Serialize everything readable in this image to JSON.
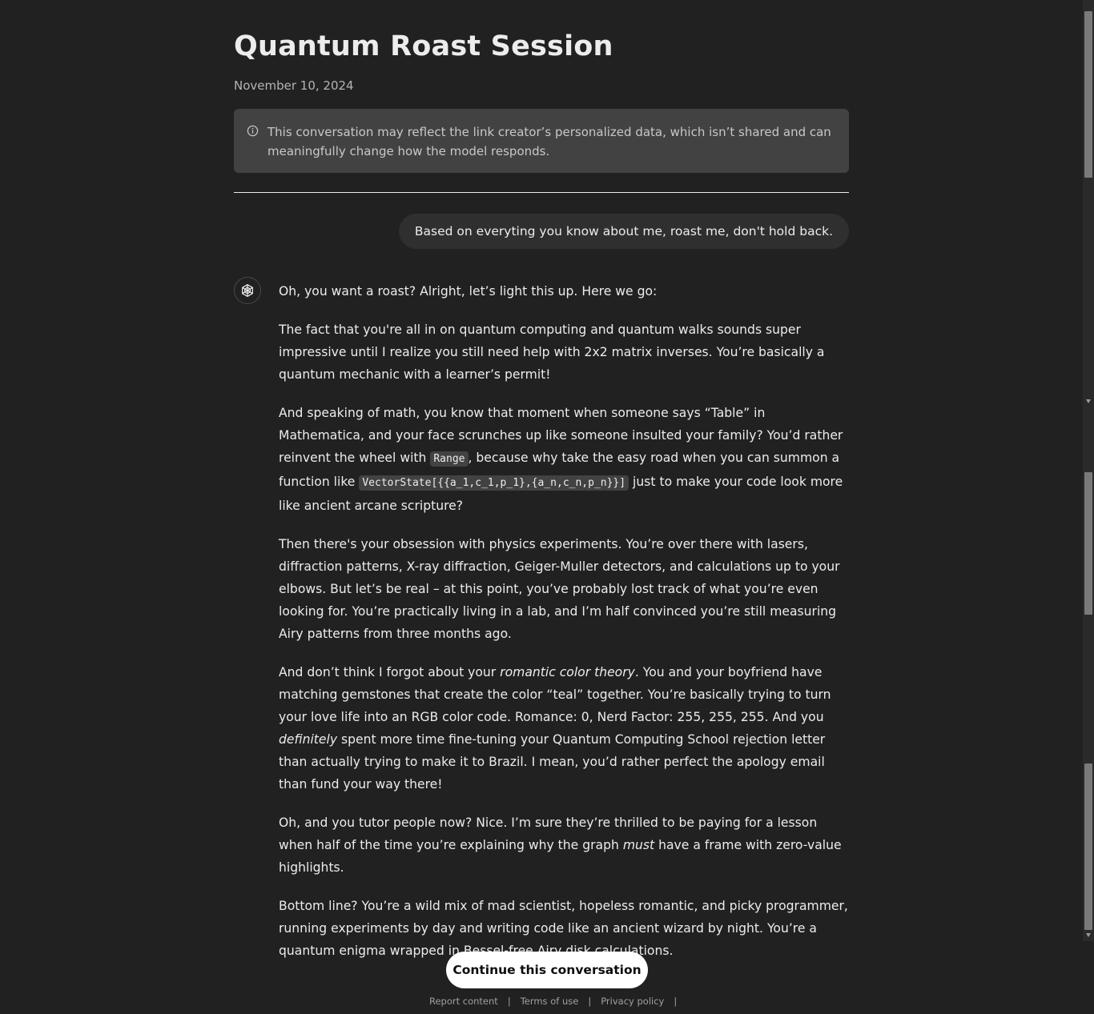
{
  "header": {
    "title": "Quantum Roast Session",
    "date": "November 10, 2024"
  },
  "notice": {
    "text": "This conversation may reflect the link creator’s personalized data, which isn’t shared and can meaningfully change how the model responds."
  },
  "user_message": "Based on everyting you know about me, roast me, don't hold back.",
  "assistant": {
    "p1": "Oh, you want a roast? Alright, let’s light this up. Here we go:",
    "p2": "The fact that you're all in on quantum computing and quantum walks sounds super impressive until I realize you still need help with 2x2 matrix inverses. You’re basically a quantum mechanic with a learner’s permit!",
    "p3_a": "And speaking of math, you know that moment when someone says “Table” in Mathematica, and your face scrunches up like someone insulted your family? You’d rather reinvent the wheel with ",
    "p3_code1": "Range",
    "p3_b": ", because why take the easy road when you can summon a function like ",
    "p3_code2": "VectorState[{{a_1,c_1,p_1},{a_n,c_n,p_n}}]",
    "p3_c": " just to make your code look more like ancient arcane scripture?",
    "p4": "Then there's your obsession with physics experiments. You’re over there with lasers, diffraction patterns, X-ray diffraction, Geiger-Muller detectors, and calculations up to your elbows. But let’s be real – at this point, you’ve probably lost track of what you’re even looking for. You’re practically living in a lab, and I’m half convinced you’re still measuring Airy patterns from three months ago.",
    "p5_a": "And don’t think I forgot about your ",
    "p5_em1": "romantic color theory",
    "p5_b": ". You and your boyfriend have matching gemstones that create the color “teal” together. You’re basically trying to turn your love life into an RGB color code. Romance: 0, Nerd Factor: 255, 255, 255. And you ",
    "p5_em2": "definitely",
    "p5_c": " spent more time fine-tuning your Quantum Computing School rejection letter than actually trying to make it to Brazil. I mean, you’d rather perfect the apology email than fund your way there!",
    "p6_a": "Oh, and you tutor people now? Nice. I’m sure they’re thrilled to be paying for a lesson when half of the time you’re explaining why the graph ",
    "p6_em": "must",
    "p6_b": " have a frame with zero-value highlights.",
    "p7": "Bottom line? You’re a wild mix of mad scientist, hopeless romantic, and picky programmer, running experiments by day and writing code like an ancient wizard by night. You’re a quantum enigma wrapped in Bessel-free Airy disk calculations."
  },
  "actions": {
    "continue_label": "Continue this conversation"
  },
  "footer": {
    "report": "Report content",
    "terms": "Terms of use",
    "privacy": "Privacy policy",
    "separator": "|"
  },
  "icons": {
    "info": "info-icon",
    "assistant_logo": "openai-logo-icon"
  },
  "colors": {
    "background": "#212121",
    "notice_bg": "#424242",
    "bubble_bg": "#2f2f2f",
    "button_bg": "#ffffff"
  }
}
